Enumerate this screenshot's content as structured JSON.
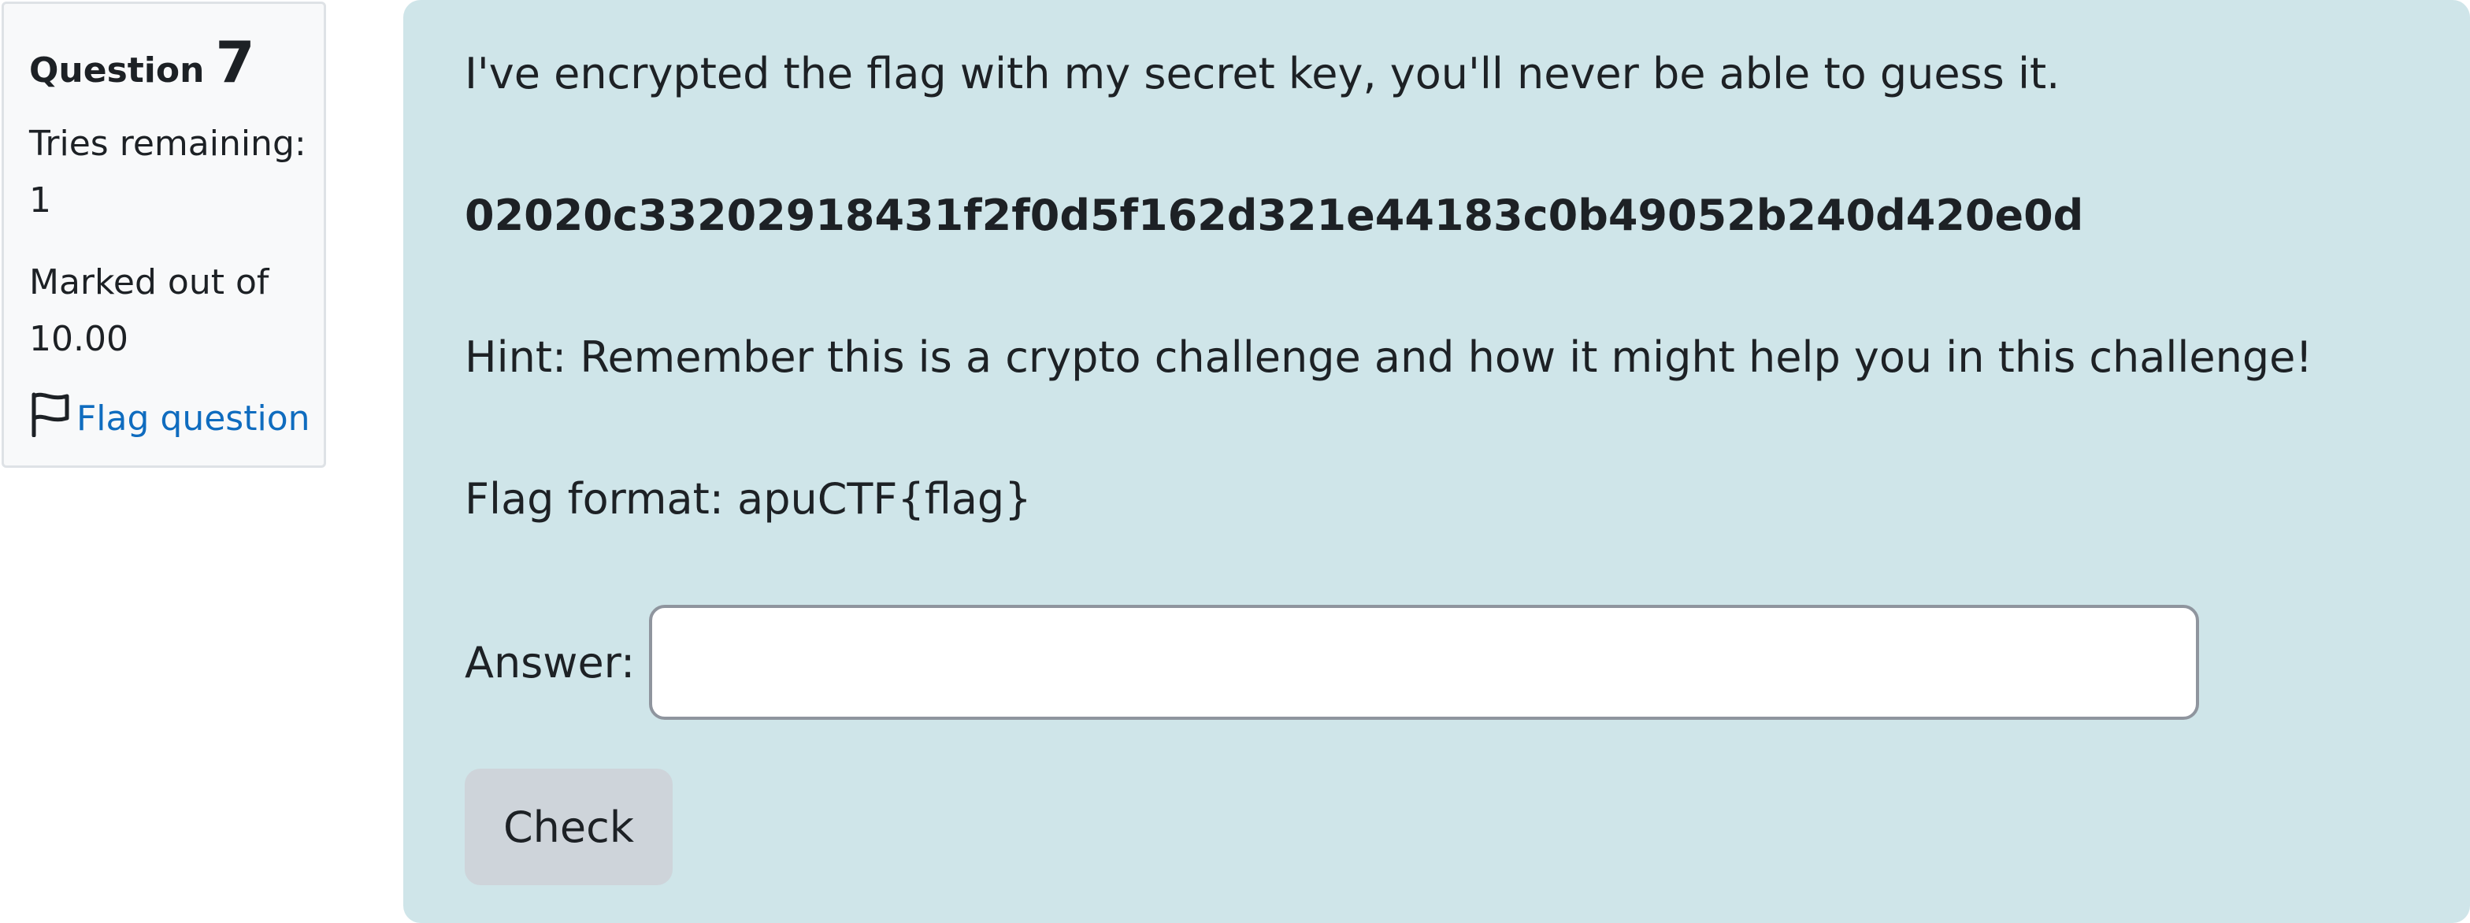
{
  "question": {
    "word": "Question",
    "number": "7",
    "tries_label": "Tries remaining:",
    "tries_value": "1",
    "marked_label": "Marked out of",
    "marked_value": "10.00",
    "flag_label": "Flag question",
    "flag_icon": "flag-outline-icon"
  },
  "content": {
    "intro": "I've encrypted the flag with my secret key, you'll never be able to guess it.",
    "ciphertext": "02020c33202918431f2f0d5f162d321e44183c0b49052b240d420e0d",
    "hint": "Hint: Remember this is a crypto challenge and how it might help you in this challenge!",
    "flag_format": "Flag format: apuCTF{flag}",
    "answer_label": "Answer:",
    "answer_value": "",
    "check_label": "Check"
  },
  "colors": {
    "content_bg": "#cfe5e9",
    "info_bg": "#f8f9fa",
    "link": "#0f6cbf",
    "button_bg": "#ced4da"
  }
}
